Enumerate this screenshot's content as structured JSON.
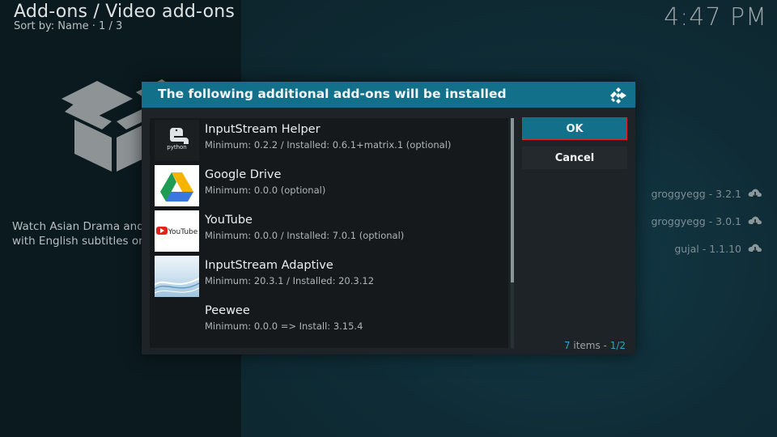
{
  "header": {
    "title": "Add-ons / Video add-ons",
    "sort": "Sort by: Name  ·  1 / 3",
    "clock": "4:47 PM"
  },
  "background": {
    "description_line1": "Watch Asian Drama and",
    "description_line2": "with English subtitles on",
    "versions": [
      {
        "label": "groggyegg - 3.2.1",
        "icon": "cloud-download-icon"
      },
      {
        "label": "groggyegg - 3.0.1",
        "icon": "cloud-download-icon"
      },
      {
        "label": "gujal - 1.1.10",
        "icon": "cloud-download-icon"
      }
    ]
  },
  "dialog": {
    "title": "The following additional add-ons will be installed",
    "items": [
      {
        "title": "InputStream Helper",
        "subtitle": "Minimum: 0.2.2 / Installed: 0.6.1+matrix.1 (optional)",
        "thumb": "python",
        "thumb_text": "python"
      },
      {
        "title": "Google Drive",
        "subtitle": "Minimum: 0.0.0 (optional)",
        "thumb": "google-drive"
      },
      {
        "title": "YouTube",
        "subtitle": "Minimum: 0.0.0 / Installed: 7.0.1 (optional)",
        "thumb": "youtube",
        "thumb_text": "YouTube"
      },
      {
        "title": "InputStream Adaptive",
        "subtitle": "Minimum: 20.3.1 / Installed: 20.3.12",
        "thumb": "wave"
      },
      {
        "title": "Peewee",
        "subtitle": "Minimum: 0.0.0 => Install: 3.15.4",
        "thumb": "none"
      }
    ],
    "ok_label": "OK",
    "cancel_label": "Cancel",
    "count_num": "7",
    "count_word": " items - ",
    "page": "1/2"
  },
  "colors": {
    "accent": "#12708b",
    "focus_border": "#e0222a",
    "highlight_text": "#2aa3c7"
  }
}
